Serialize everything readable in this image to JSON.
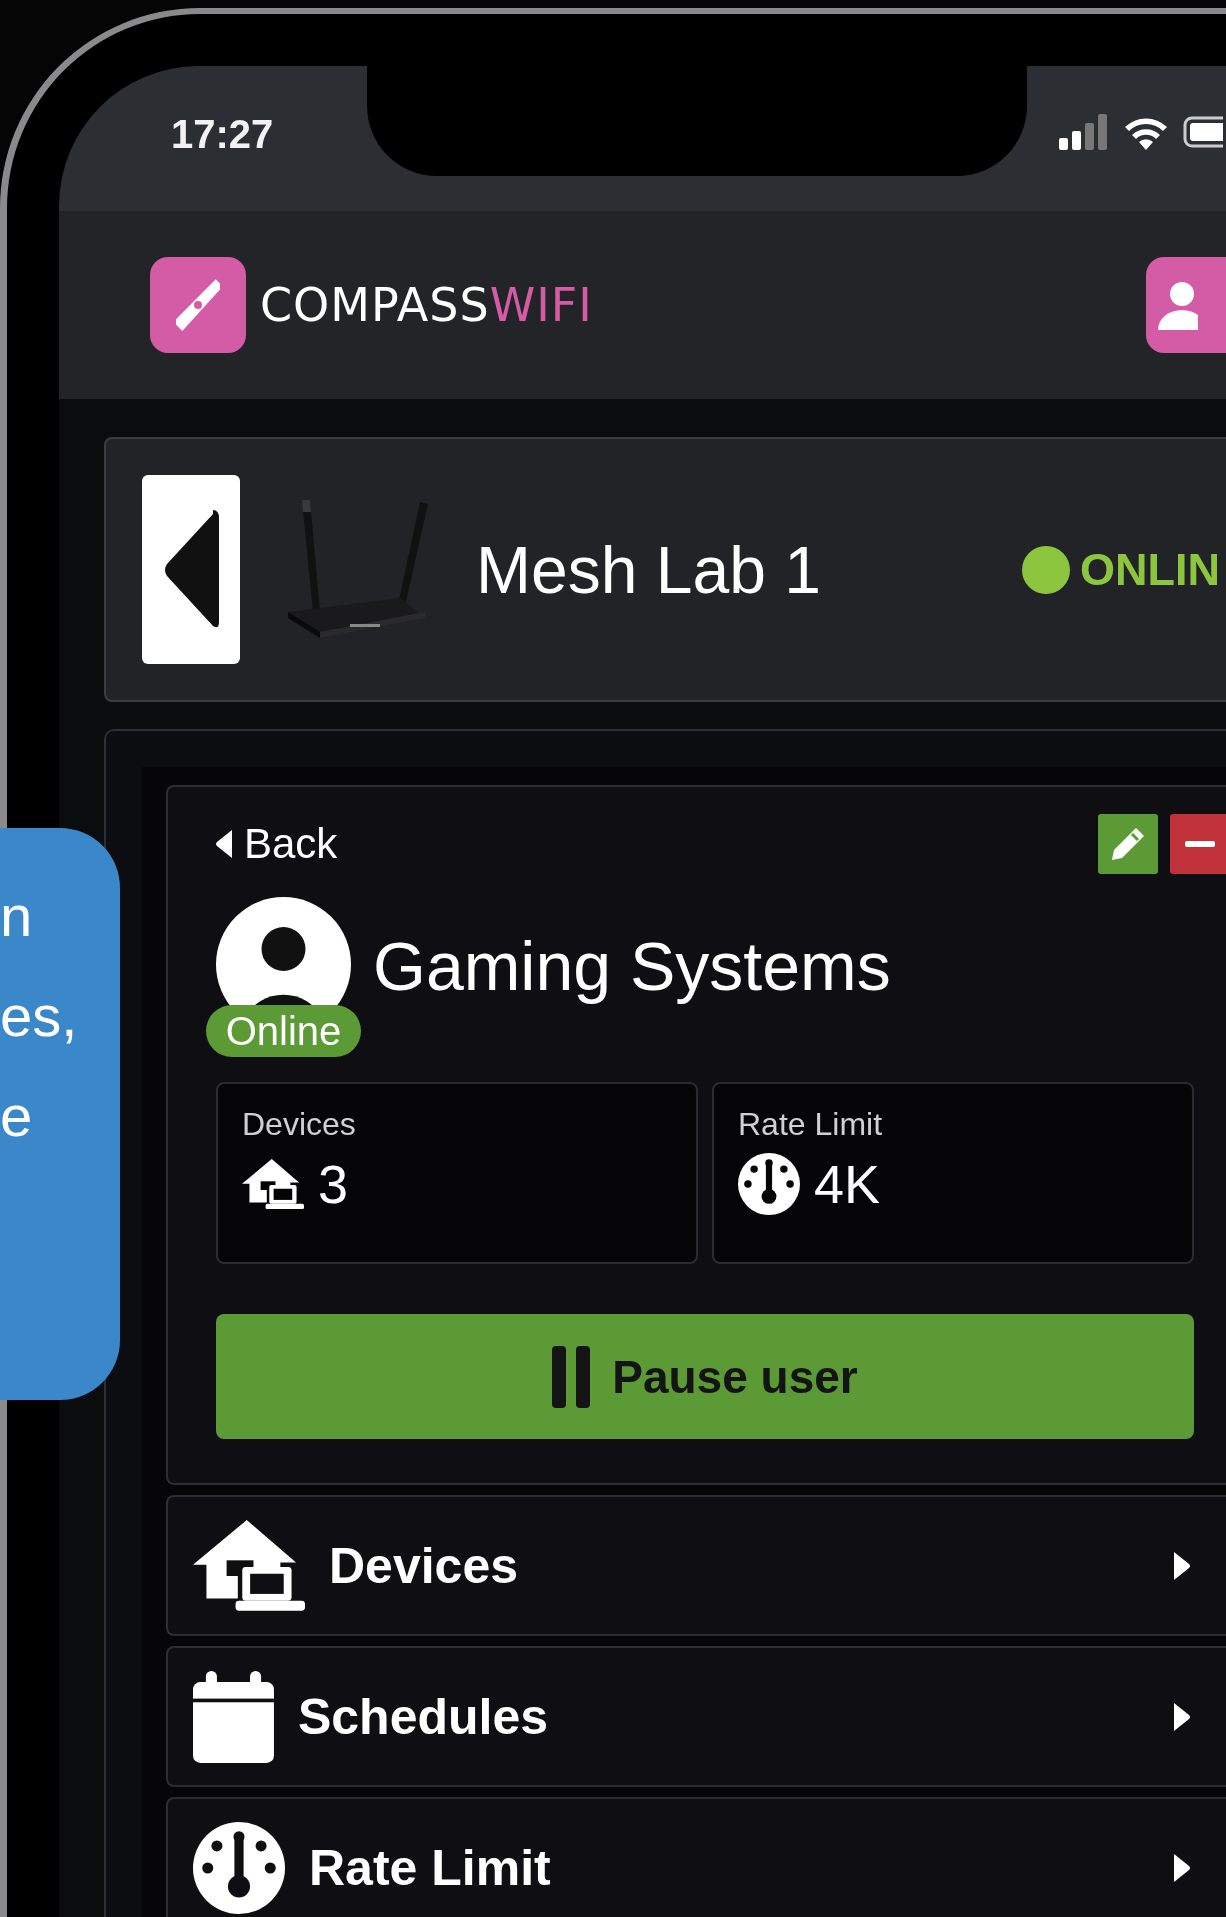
{
  "status_bar": {
    "time": "17:27"
  },
  "header": {
    "brand": [
      {
        "text": "COMPASS",
        "kind": "primary"
      },
      {
        "text": "WIFI",
        "kind": "accent"
      }
    ]
  },
  "device": {
    "name": "Mesh Lab 1",
    "status": "ONLIN",
    "online": true
  },
  "user": {
    "back": "Back",
    "name": "Gaming Systems",
    "status": "Online",
    "online": true,
    "stats": [
      {
        "label": "Devices",
        "value": "3",
        "kind": "devices"
      },
      {
        "label": "Rate Limit",
        "value": "4K",
        "kind": "gauge"
      }
    ],
    "action": "Pause user"
  },
  "menu": [
    {
      "label": "Devices",
      "kind": "devices"
    },
    {
      "label": "Schedules",
      "kind": "calendar"
    },
    {
      "label": "Rate Limit",
      "kind": "gauge"
    }
  ],
  "tooltip": {
    "lines": [
      "n",
      "es,",
      "e"
    ]
  }
}
